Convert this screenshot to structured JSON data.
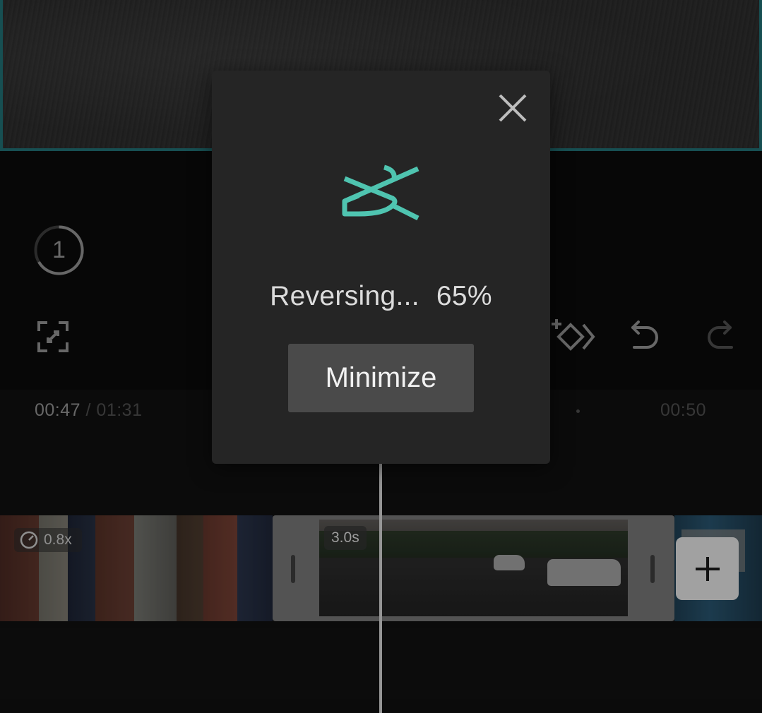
{
  "preview": {
    "border_color": "#1f6a6e"
  },
  "toolbar": {
    "timer_number": "1",
    "timer_icon": "timer-icon",
    "fullscreen_icon": "fullscreen-icon",
    "keyframe_icon": "add-keyframe-icon",
    "undo_icon": "undo-icon",
    "redo_icon": "redo-icon"
  },
  "timeline": {
    "current_time": "00:47",
    "separator": "/",
    "total_time": "01:31",
    "mark_time": "00:50",
    "speed_badge": "0.8x",
    "duration_badge": "3.0s",
    "add_icon": "plus-icon"
  },
  "dialog": {
    "status_text": "Reversing...",
    "progress_percent": "65%",
    "progress": 0.65,
    "minimize_label": "Minimize",
    "close_icon": "close-icon",
    "logo": "capcut-logo",
    "accent_color": "#4fc4b0"
  }
}
